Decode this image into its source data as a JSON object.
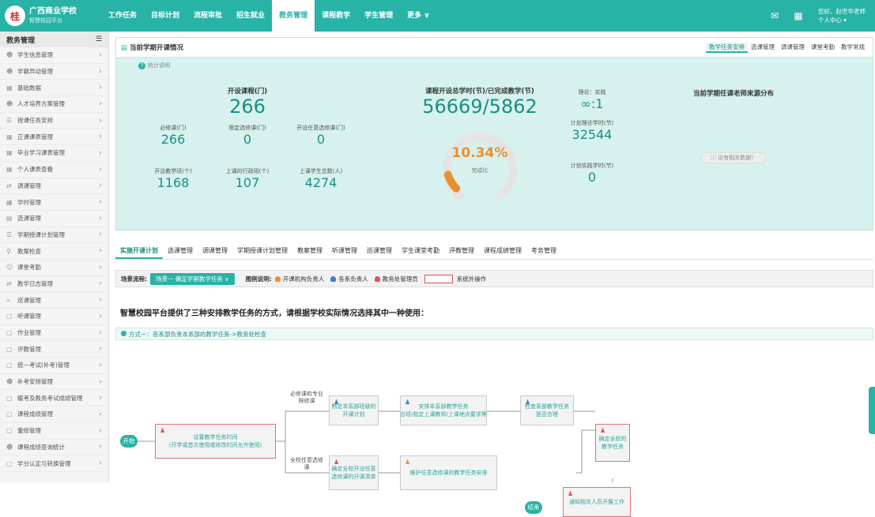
{
  "header": {
    "school_name": "广西商业学校",
    "school_sub": "智慧校园平台",
    "nav": [
      "工作任务",
      "目标计划",
      "流程审批",
      "招生就业",
      "教务管理",
      "课程教学",
      "学生管理",
      "更多 ∨"
    ],
    "active_nav": "教务管理",
    "user_greeting": "您好，赵世华老师",
    "user_center": "个人中心 ▾"
  },
  "sidebar": {
    "title": "教务管理",
    "items": [
      "学生信息管理",
      "学籍异动管理",
      "基础数据",
      "人才培养方案管理",
      "授课任务安排",
      "正课课表管理",
      "毕业学习课表管理",
      "个人课表查看",
      "调课管理",
      "学时管理",
      "选课管理",
      "学期授课计划管理",
      "教案检查",
      "课堂考勤",
      "教学日志管理",
      "巡课管理",
      "听课管理",
      "作业管理",
      "评教管理",
      "统一考试(补考)管理",
      "补考安排管理",
      "缓考及教务考试成绩管理",
      "课程成绩管理",
      "重修管理",
      "课程成绩查询统计",
      "学分认定与转换管理"
    ]
  },
  "card": {
    "title": "当前学期开课情况",
    "tabs": [
      "教学任务安排",
      "选课管理",
      "调课管理",
      "课堂考勤",
      "教学常规"
    ],
    "help": "统计说明",
    "open_label": "开设课程(门)",
    "open_value": "266",
    "required_label": "必修课(门)",
    "required_value": "266",
    "limited_label": "限定选修课(门)",
    "limited_value": "0",
    "elective_label": "开设任意选修课(门)",
    "elective_value": "0",
    "teachers_label": "开设教学班(个)",
    "teachers_value": "1168",
    "classes_label": "上课的行政班(个)",
    "classes_value": "107",
    "students_label": "上课学生总数(人)",
    "students_value": "4274",
    "hours_label": "课程开设总学时(节)/已完成教学(节)",
    "hours_value": "56669/5862",
    "gauge_pct": "10.34%",
    "gauge_fraction": 0.1034,
    "gauge_label": "完成比",
    "ratio_label": "理论：实践",
    "ratio_value": "∞:1",
    "plan_theory_label": "计划理论学时(节)",
    "plan_theory_value": "32544",
    "plan_practice_label": "计划实践学时(节)",
    "plan_practice_value": "0",
    "dist_title": "当前学期任课老师来源分布",
    "nodata": "没有相关数据！"
  },
  "tabs2": [
    "实施开课计划",
    "选课管理",
    "调课管理",
    "学期授课计划管理",
    "教案管理",
    "听课管理",
    "巡课管理",
    "学生课堂考勤",
    "评教管理",
    "课程成绩管理",
    "考务管理"
  ],
  "flow": {
    "label": "场景流程:",
    "select": "场景一 确定学期教学任务 ∨",
    "legend_label": "图例说明:",
    "legend": [
      "开课机构负责人",
      "各系负责人",
      "教务处管理员"
    ],
    "legend_colors": [
      "#e89030",
      "#3a7fd0",
      "#e05050"
    ],
    "legend_box": "系统外操作"
  },
  "heading": "智慧校园平台提供了三种安排教学任务的方式，请根据学校实际情况选择其中一种使用：",
  "method": "方式一：各系部负责本系部的教学任务->教务处检查",
  "diagram": {
    "start": "开始",
    "end": "结束",
    "n1": "设置教学任务时间\n(开学或首次使用或修改时间允许使用)",
    "n2": "制定本系部班级的开课计划",
    "n3": "安排本系部教学任务\n合班/指定上课教师/上课地点要求等",
    "n4": "检查系部教学任务是否合理",
    "n5": "确定全校的教学任务",
    "n6": "确定全校开设任意选修课的开课清单",
    "n7": "维护任意选修课的教学任务安排",
    "n8": "通知相关人员开展工作",
    "l1": "必修课和专业限修课",
    "l2": "全校任意选修课"
  }
}
